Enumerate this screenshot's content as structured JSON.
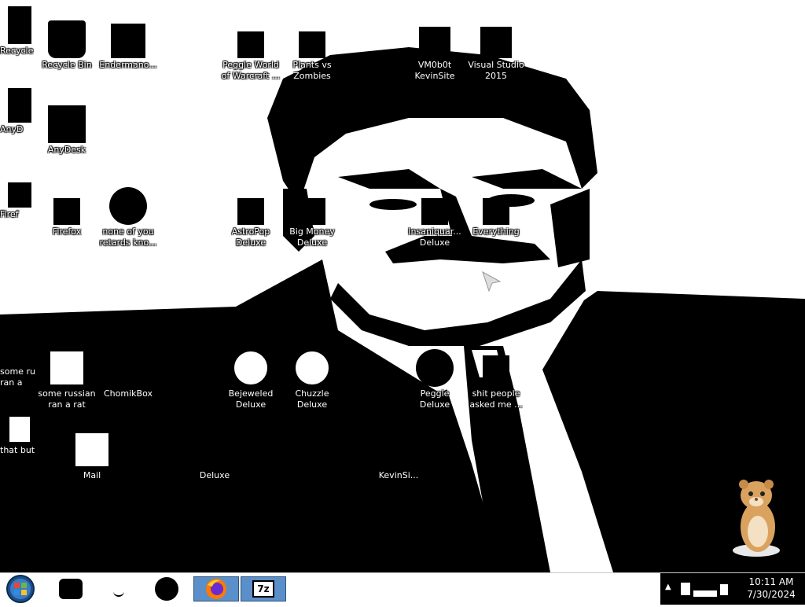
{
  "desktop": {
    "icons": [
      {
        "label": "Recycle Bin",
        "icon": "recycle-bin-icon"
      },
      {
        "label": "Endermano...",
        "icon": "document-icon"
      },
      {
        "label": "Peggle World of Warcraft ...",
        "icon": "peggle-icon"
      },
      {
        "label": "Plants vs Zombies",
        "icon": "plants-vs-zombies-icon"
      },
      {
        "label": "VM0b0t KevinSite",
        "icon": "shortcut-icon"
      },
      {
        "label": "Visual Studio 2015",
        "icon": "visual-studio-icon"
      },
      {
        "label": "AnyDesk",
        "icon": "anydesk-icon"
      },
      {
        "label": "Firefox",
        "icon": "firefox-icon"
      },
      {
        "label": "none of you retards kno...",
        "icon": "globe-icon"
      },
      {
        "label": "AstroPop Deluxe",
        "icon": "astropop-icon"
      },
      {
        "label": "Big Money Deluxe",
        "icon": "big-money-icon"
      },
      {
        "label": "Insaniquar... Deluxe",
        "icon": "insaniquarium-icon"
      },
      {
        "label": "Everything",
        "icon": "everything-search-icon"
      },
      {
        "label": "some russian ran a rat",
        "icon": "file-icon"
      },
      {
        "label": "ChomikBox",
        "icon": "chomikbox-icon"
      },
      {
        "label": "Bejeweled Deluxe",
        "icon": "bejeweled-icon"
      },
      {
        "label": "Chuzzle Deluxe",
        "icon": "chuzzle-icon"
      },
      {
        "label": "Peggle Deluxe",
        "icon": "peggle-deluxe-icon"
      },
      {
        "label": "shit people asked me ...",
        "icon": "text-file-icon"
      },
      {
        "label": "Mail",
        "icon": "mail-icon"
      },
      {
        "label": "Deluxe",
        "icon": "game-icon"
      },
      {
        "label": "KevinSi...",
        "icon": "shortcut-icon"
      }
    ],
    "ghost_icons": [
      {
        "label": "Recycle",
        "icon": "recycle-bin-icon"
      },
      {
        "label": "AnyD",
        "icon": "anydesk-icon"
      },
      {
        "label": "Firef",
        "icon": "firefox-icon"
      },
      {
        "label": "some ru ran a",
        "icon": "file-icon"
      },
      {
        "label": "that but",
        "icon": "file-icon"
      }
    ]
  },
  "taskbar": {
    "start": {
      "icon": "windows-start-orb-icon"
    },
    "pinned": [
      {
        "icon": "pinned-app-icon"
      },
      {
        "icon": "pinned-app-icon"
      },
      {
        "icon": "pinned-app-icon"
      },
      {
        "icon": "firefox-icon"
      },
      {
        "icon": "seven-zip-icon",
        "text": "7z"
      }
    ],
    "tray": {
      "show_hidden": "▲",
      "time": "10:11 AM",
      "date": "7/30/2024"
    }
  },
  "colors": {
    "wallpaper_dark": "#000000",
    "wallpaper_light": "#ffffff",
    "active_taskbar_button": "#5b8fc9"
  }
}
